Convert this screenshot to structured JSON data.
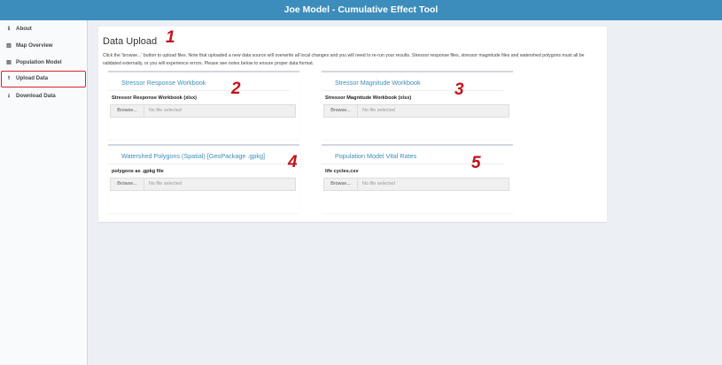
{
  "header": {
    "title": "Joe Model - Cumulative Effect Tool"
  },
  "sidebar": {
    "items": [
      {
        "label": "About",
        "icon": "info-icon"
      },
      {
        "label": "Map Overview",
        "icon": "map-icon"
      },
      {
        "label": "Population Model",
        "icon": "list-icon"
      },
      {
        "label": "Upload Data",
        "icon": "upload-icon",
        "active": true
      },
      {
        "label": "Download Data",
        "icon": "download-icon"
      }
    ]
  },
  "main": {
    "title": "Data Upload",
    "intro": "Click the 'browse...' button to upload files. Note that uploaded a new data source will overwrite all local changes and you will need to re-run your results. Stressor response files, stressor magnitude files and watershed polygons must all be validated externally, or you will experience errors. Please see notes below to ensure proper data format.",
    "annotations": [
      "1",
      "2",
      "3",
      "4",
      "5"
    ],
    "cards": [
      {
        "title": "Stressor Response Workbook",
        "label": "Stressor Response Workbook (xlsx)",
        "button": "Browse...",
        "placeholder": "No file selected"
      },
      {
        "title": "Stressor Magnitude Workbook",
        "label": "Stressor Magnitude Workbook (xlsx)",
        "button": "Browse...",
        "placeholder": "No file selected"
      },
      {
        "title": "Watershed Polygons (Spatial) [GeoPackage .gpkg]",
        "label": "polygons as .gpkg file",
        "button": "Browse...",
        "placeholder": "No file selected"
      },
      {
        "title": "Population Model Vital Rates",
        "label": "life cycles.csv",
        "button": "Browse...",
        "placeholder": "No file selected"
      }
    ]
  },
  "colors": {
    "header": "#3c8dbc",
    "accent": "#3c8dbc",
    "annotation": "#c0141c",
    "highlight": "#d9232d"
  }
}
